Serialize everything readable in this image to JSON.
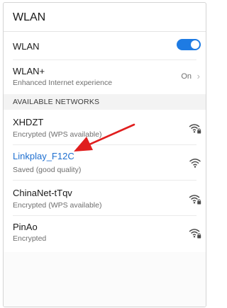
{
  "title_bar": {
    "title": "WLAN"
  },
  "wlan_toggle": {
    "label": "WLAN",
    "state": "on",
    "accent": "#1e7be3"
  },
  "wlan_plus": {
    "label": "WLAN+",
    "subtitle": "Enhanced Internet experience",
    "value": "On"
  },
  "available_section": {
    "header": "AVAILABLE NETWORKS"
  },
  "networks": [
    {
      "name": "XHDZT",
      "status": "Encrypted (WPS available)",
      "icon": "wifi-lock-icon"
    },
    {
      "name": "Linkplay_F12C",
      "status": "Saved (good quality)",
      "icon": "wifi-icon",
      "highlight_color": "#1e6fd0"
    },
    {
      "name": "ChinaNet-tTqv",
      "status": "Encrypted (WPS available)",
      "icon": "wifi-lock-icon"
    },
    {
      "name": "PinAo",
      "status": "Encrypted",
      "icon": "wifi-lock-icon"
    }
  ],
  "annotation": {
    "arrow_color": "#e01e1e"
  }
}
